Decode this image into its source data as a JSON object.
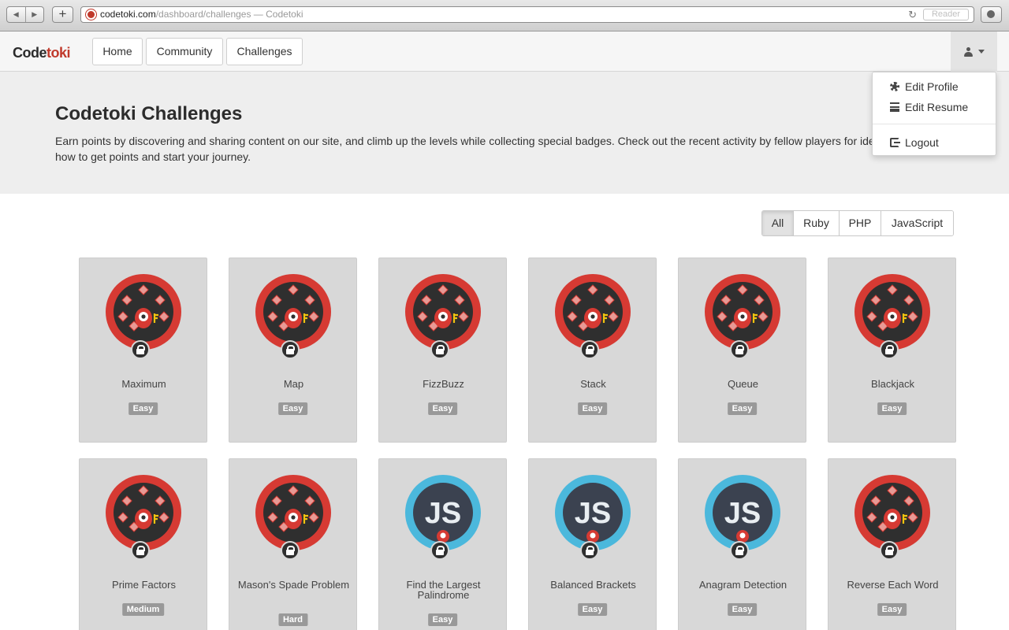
{
  "browser": {
    "url_host": "codetoki.com",
    "url_path": "/dashboard/challenges",
    "url_title": " — Codetoki",
    "reader_label": "Reader",
    "add_tab": "+"
  },
  "navbar": {
    "logo_first": "Code",
    "logo_second": "toki",
    "items": [
      {
        "label": "Home"
      },
      {
        "label": "Community"
      },
      {
        "label": "Challenges"
      }
    ]
  },
  "user_menu": {
    "items": [
      {
        "label": "Edit Profile",
        "icon": "gear-icon"
      },
      {
        "label": "Edit Resume",
        "icon": "list-icon"
      },
      {
        "label": "Logout",
        "icon": "sign-out-icon"
      }
    ]
  },
  "hero": {
    "title": "Codetoki Challenges",
    "description": "Earn points by discovering and sharing content on our site, and climb up the levels while collecting special badges. Check out the recent activity by fellow players for ideas on how to get points and start your journey."
  },
  "filters": {
    "selected": "All",
    "options": [
      "All",
      "Ruby",
      "PHP",
      "JavaScript"
    ]
  },
  "colors": {
    "brand": "#c0392b",
    "ruby_ring": "#d63a33",
    "js_ring": "#4bb8dc",
    "badge_dark": "#2f2f2f",
    "card_bg": "#d8d8d8",
    "level_bg": "#999999"
  },
  "challenges": [
    {
      "title": "Maximum",
      "level": "Easy",
      "badge": "ruby",
      "locked": true
    },
    {
      "title": "Map",
      "level": "Easy",
      "badge": "ruby",
      "locked": true
    },
    {
      "title": "FizzBuzz",
      "level": "Easy",
      "badge": "ruby",
      "locked": true
    },
    {
      "title": "Stack",
      "level": "Easy",
      "badge": "ruby",
      "locked": true
    },
    {
      "title": "Queue",
      "level": "Easy",
      "badge": "ruby",
      "locked": true
    },
    {
      "title": "Blackjack",
      "level": "Easy",
      "badge": "ruby",
      "locked": true
    },
    {
      "title": "Prime Factors",
      "level": "Medium",
      "badge": "ruby",
      "locked": true
    },
    {
      "title": "Mason's Spade Problem",
      "level": "Hard",
      "badge": "ruby",
      "locked": true
    },
    {
      "title": "Find the Largest Palindrome",
      "level": "Easy",
      "badge": "js",
      "badge_text": "JS",
      "locked": true
    },
    {
      "title": "Balanced Brackets",
      "level": "Easy",
      "badge": "js",
      "badge_text": "JS",
      "locked": true
    },
    {
      "title": "Anagram Detection",
      "level": "Easy",
      "badge": "js",
      "badge_text": "JS",
      "locked": true
    },
    {
      "title": "Reverse Each Word",
      "level": "Easy",
      "badge": "ruby",
      "locked": true
    }
  ]
}
